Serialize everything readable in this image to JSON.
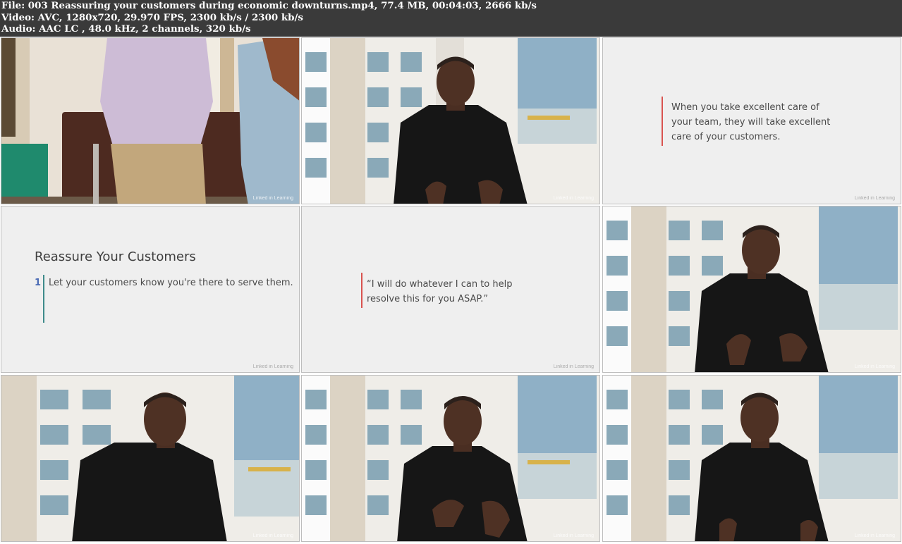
{
  "header": {
    "line1": "File: 003 Reassuring your customers during economic downturns.mp4, 77.4 MB, 00:04:03, 2666 kb/s",
    "line2": "Video: AVC, 1280x720, 29.970 FPS, 2300 kb/s / 2300 kb/s",
    "line3": "Audio: AAC LC , 48.0 kHz, 2 channels, 320 kb/s"
  },
  "watermark": "Linked in Learning",
  "slides": {
    "quote1": "When you take excellent care of your team, they will take excellent care of your customers.",
    "title": "Reassure Your Customers",
    "item_number": "1",
    "item_text": "Let your customers know you're there to serve them.",
    "quote2": "“I will do whatever I can to help resolve this for you ASAP.”"
  },
  "colors": {
    "header_bg": "#3a3a3a",
    "quote_bar": "#d9534f",
    "item_bar": "#3d8a8a",
    "item_number": "#4b6bb5"
  }
}
